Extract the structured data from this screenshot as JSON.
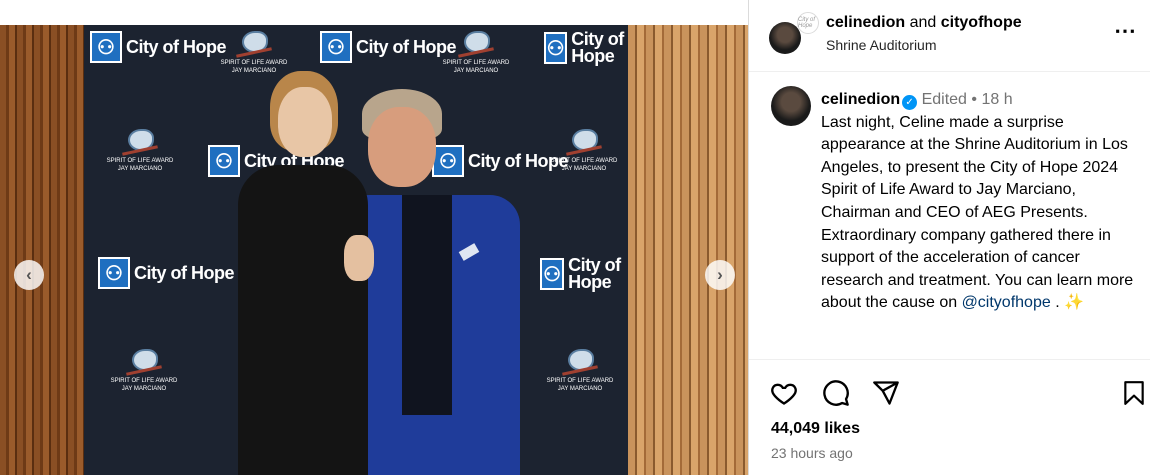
{
  "post": {
    "header": {
      "user": "celinedion",
      "conjunction": "and",
      "collaborator": "cityofhope",
      "location": "Shrine Auditorium",
      "collab_avatar_text": "City of Hope"
    },
    "caption": {
      "user": "celinedion",
      "edited": "Edited",
      "dot": "•",
      "age": "18 h",
      "text": "Last night, Celine made a surprise appearance at the Shrine Auditorium in Los Angeles, to present the City of Hope 2024 Spirit of Life Award to Jay Marciano, Chairman and CEO of AEG Presents. Extraordinary company gathered there in support of the acceleration of cancer research and treatment. You can learn more about the cause on",
      "mention": "@cityofhope",
      "tail": " .",
      "emoji": "✨"
    },
    "likes": "44,049 likes",
    "timestamp": "23 hours ago"
  },
  "photo": {
    "logo_text": "City of Hope",
    "award_text": "SPIRIT OF LIFE AWARD",
    "honoree_text": "JAY MARCIANO"
  },
  "icons": {
    "like": "heart-icon",
    "comment": "comment-icon",
    "share": "share-icon",
    "save": "bookmark-icon",
    "more": "more-icon",
    "prev": "chevron-left-icon",
    "next": "chevron-right-icon",
    "verified": "verified-badge-icon"
  },
  "colors": {
    "verified": "#0095f6",
    "mention": "#00376b",
    "meta": "#737373",
    "logo_blue": "#1f6fc0"
  }
}
